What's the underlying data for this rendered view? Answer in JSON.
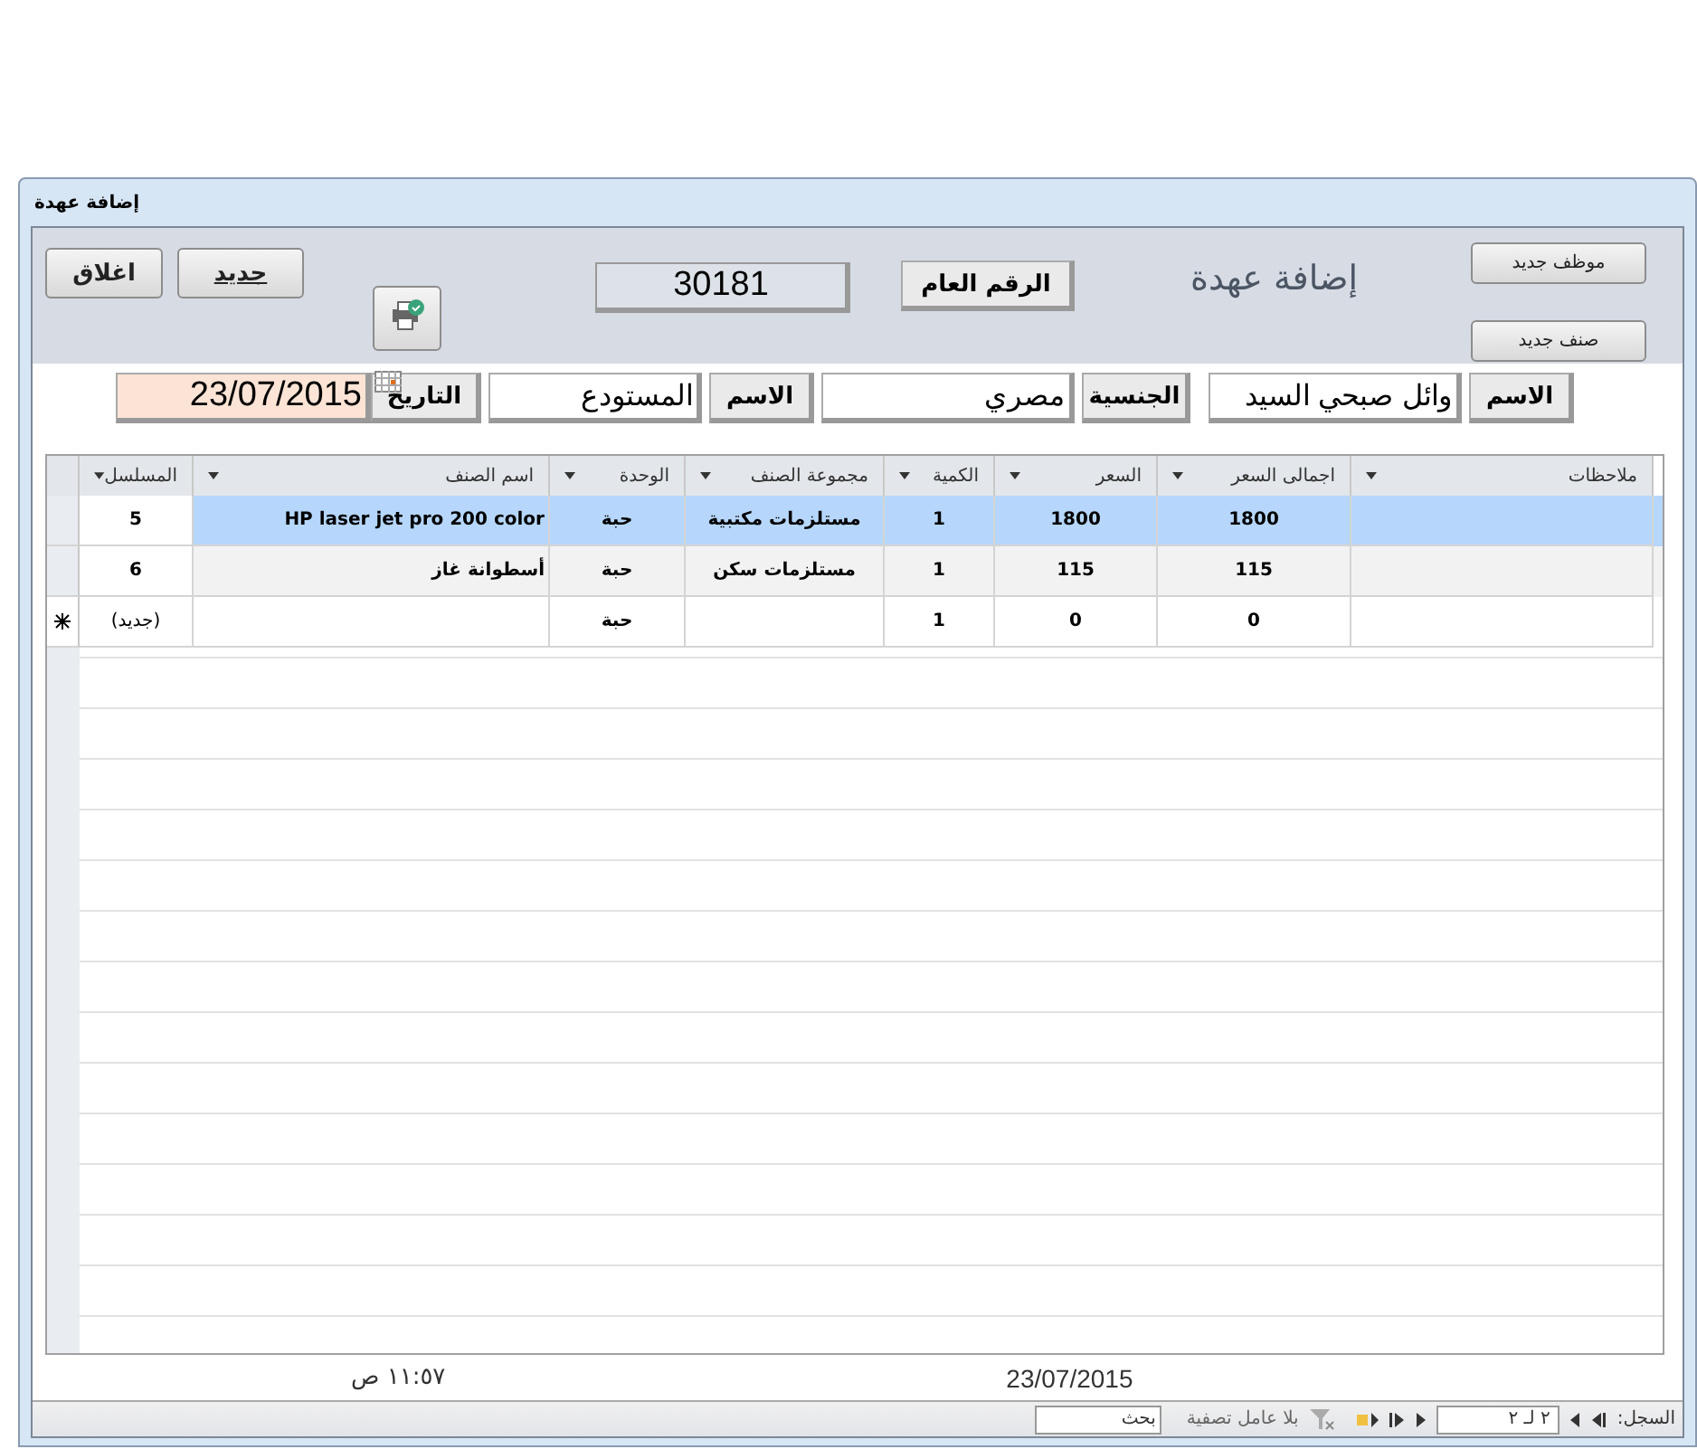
{
  "window": {
    "title": "إضافة عهدة"
  },
  "header": {
    "buttons": [
      {
        "label": "جديد",
        "kind": "new"
      },
      {
        "label": "اغلاق",
        "kind": "close"
      }
    ],
    "record_number": "30181",
    "record_number_label": "الرقم العام",
    "form_title": "إضافة عهدة",
    "side_buttons": [
      "موظف جديد",
      "صنف جديد"
    ]
  },
  "fields": [
    {
      "label": "الاسم",
      "value": "وائل صبحي السيد",
      "kind": "text"
    },
    {
      "label": "الجنسية",
      "value": "مصري",
      "kind": "text"
    },
    {
      "label": "الاسم",
      "value": "المستودع",
      "kind": "text"
    },
    {
      "label": "التاريخ",
      "value": "23/07/2015",
      "kind": "date"
    }
  ],
  "table": {
    "columns": [
      "ملاحظات",
      "اجمالى السعر",
      "السعر",
      "الكمية",
      "مجموعة الصنف",
      "الوحدة",
      "اسم الصنف",
      "المسلسل"
    ],
    "rows": [
      {
        "kind": "record",
        "selected": true,
        "cells": [
          "",
          "1800",
          "1800",
          "1",
          "مستلزمات مكتبية",
          "حبة",
          "HP laser jet pro 200 color",
          "5"
        ]
      },
      {
        "kind": "record",
        "selected": false,
        "cells": [
          "",
          "115",
          "115",
          "1",
          "مستلزمات سكن",
          "حبة",
          "أسطوانة غاز",
          "6"
        ]
      },
      {
        "kind": "new",
        "selected": false,
        "cells": [
          "",
          "0",
          "0",
          "1",
          "",
          "حبة",
          "",
          "(جديد)"
        ]
      }
    ]
  },
  "footer": {
    "time": "١١:٥٧ ص",
    "date": "23/07/2015"
  },
  "navigation": {
    "label": "السجل:",
    "position": "٢ لـ ٢",
    "filter": "بلا عامل تصفية",
    "search_placeholder": "بحث"
  }
}
